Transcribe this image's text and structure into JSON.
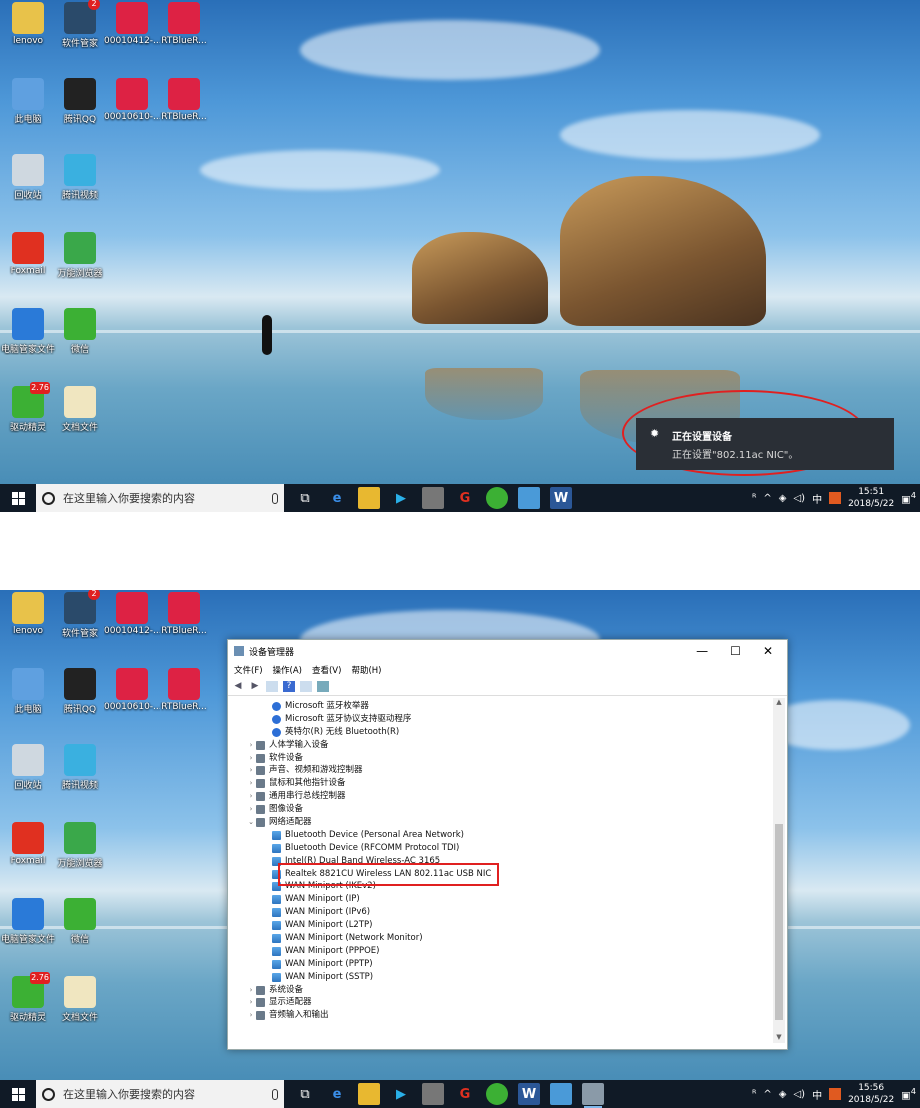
{
  "colors": {
    "accent": "#e02020",
    "taskbar": "#101a26",
    "toast": "#2a2f36"
  },
  "desktop_icons": [
    {
      "label": "lenovo",
      "icon": "folder-user-icon",
      "color": "#e8c24a"
    },
    {
      "label": "软件管家",
      "icon": "shield-icon",
      "color": "#2a4a6a",
      "badge": "2"
    },
    {
      "label": "00010412-...",
      "icon": "winrar-icon",
      "color": "#d24"
    },
    {
      "label": "RTBlueR...",
      "icon": "winrar-icon",
      "color": "#d24"
    },
    {
      "label": "此电脑",
      "icon": "computer-icon",
      "color": "#5fa0e0"
    },
    {
      "label": "腾讯QQ",
      "icon": "qq-penguin-icon",
      "color": "#222"
    },
    {
      "label": "00010610-...",
      "icon": "winrar-icon",
      "color": "#d24"
    },
    {
      "label": "RTBlueR...",
      "icon": "winrar-icon",
      "color": "#d24"
    },
    {
      "label": "回收站",
      "icon": "recycle-bin-icon",
      "color": "#cfd8e0"
    },
    {
      "label": "腾讯视频",
      "icon": "play-icon",
      "color": "#3ab0e0"
    },
    {
      "label": "Foxmail",
      "icon": "foxmail-icon",
      "color": "#e03020"
    },
    {
      "label": "万能浏览器",
      "icon": "browser-e-icon",
      "color": "#3aa84a"
    },
    {
      "label": "电脑管家文件",
      "icon": "ie-icon",
      "color": "#2a7ad8"
    },
    {
      "label": "微信",
      "icon": "wechat-icon",
      "color": "#3cb034"
    },
    {
      "label": "驱动精灵",
      "icon": "driver-icon",
      "color": "#3cb034",
      "badge": "2.76"
    },
    {
      "label": "文档文件",
      "icon": "document-icon",
      "color": "#f0e6c0"
    }
  ],
  "taskbar": {
    "search_placeholder": "在这里输入你要搜索的内容",
    "ime": "中",
    "clock1_time": "15:51",
    "clock1_date": "2018/5/22",
    "clock2_time": "15:56",
    "clock2_date": "2018/5/22",
    "notif_count": "4"
  },
  "toast": {
    "title": "正在设置设备",
    "message": "正在设置\"802.11ac NIC\"。"
  },
  "device_manager": {
    "title": "设备管理器",
    "menu": [
      "文件(F)",
      "操作(A)",
      "查看(V)",
      "帮助(H)"
    ],
    "tree": [
      {
        "label": "Microsoft 蓝牙枚举器",
        "level": 1,
        "type": "bt"
      },
      {
        "label": "Microsoft 蓝牙协议支持驱动程序",
        "level": 1,
        "type": "bt"
      },
      {
        "label": "英特尔(R) 无线 Bluetooth(R)",
        "level": 1,
        "type": "bt"
      },
      {
        "label": "人体学输入设备",
        "level": 0,
        "type": "cat",
        "arrow": ">"
      },
      {
        "label": "软件设备",
        "level": 0,
        "type": "cat",
        "arrow": ">"
      },
      {
        "label": "声音、视频和游戏控制器",
        "level": 0,
        "type": "cat",
        "arrow": ">"
      },
      {
        "label": "鼠标和其他指针设备",
        "level": 0,
        "type": "cat",
        "arrow": ">"
      },
      {
        "label": "通用串行总线控制器",
        "level": 0,
        "type": "cat",
        "arrow": ">"
      },
      {
        "label": "图像设备",
        "level": 0,
        "type": "cat",
        "arrow": ">"
      },
      {
        "label": "网络适配器",
        "level": 0,
        "type": "cat",
        "arrow": "v"
      },
      {
        "label": "Bluetooth Device (Personal Area Network)",
        "level": 1,
        "type": "net"
      },
      {
        "label": "Bluetooth Device (RFCOMM Protocol TDI)",
        "level": 1,
        "type": "net"
      },
      {
        "label": "Intel(R) Dual Band Wireless-AC 3165",
        "level": 1,
        "type": "net"
      },
      {
        "label": "Realtek 8821CU Wireless LAN 802.11ac USB NIC",
        "level": 1,
        "type": "net"
      },
      {
        "label": "WAN Miniport (IKEv2)",
        "level": 1,
        "type": "net"
      },
      {
        "label": "WAN Miniport (IP)",
        "level": 1,
        "type": "net"
      },
      {
        "label": "WAN Miniport (IPv6)",
        "level": 1,
        "type": "net"
      },
      {
        "label": "WAN Miniport (L2TP)",
        "level": 1,
        "type": "net"
      },
      {
        "label": "WAN Miniport (Network Monitor)",
        "level": 1,
        "type": "net"
      },
      {
        "label": "WAN Miniport (PPPOE)",
        "level": 1,
        "type": "net"
      },
      {
        "label": "WAN Miniport (PPTP)",
        "level": 1,
        "type": "net"
      },
      {
        "label": "WAN Miniport (SSTP)",
        "level": 1,
        "type": "net"
      },
      {
        "label": "系统设备",
        "level": 0,
        "type": "cat",
        "arrow": ">"
      },
      {
        "label": "显示适配器",
        "level": 0,
        "type": "cat",
        "arrow": ">"
      },
      {
        "label": "音频输入和输出",
        "level": 0,
        "type": "cat",
        "arrow": ">"
      }
    ]
  }
}
